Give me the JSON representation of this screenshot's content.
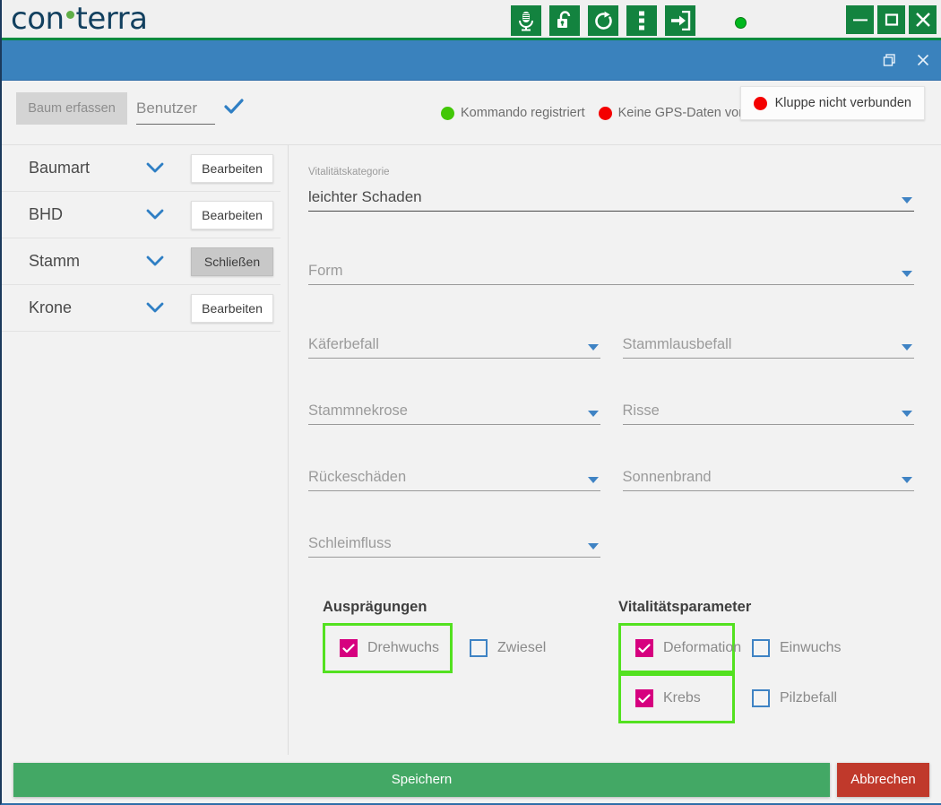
{
  "brand": {
    "logo_part1": "con",
    "logo_part2": "terra",
    "logo_dot": "green-dot"
  },
  "toolbar": {
    "icons": [
      {
        "name": "microphone-icon",
        "label": "Mikrofon"
      },
      {
        "name": "unlock-icon",
        "label": "Entsperren"
      },
      {
        "name": "refresh-icon",
        "label": "Aktualisieren"
      },
      {
        "name": "more-vertical-icon",
        "label": "Mehr"
      },
      {
        "name": "login-icon",
        "label": "Anmelden"
      }
    ],
    "status_led": "green"
  },
  "window_controls": {
    "minimize": "minimize-icon",
    "maximize": "maximize-icon",
    "close": "close-icon"
  },
  "sub_window": {
    "restore": "restore-icon",
    "close": "close-icon"
  },
  "action_bar": {
    "capture_button": "Baum erfassen",
    "user_placeholder": "Benutzer",
    "user_value": "",
    "confirm_icon": "check-icon",
    "status": [
      {
        "label": "Kommando registriert",
        "color": "#42c707"
      },
      {
        "label": "Keine GPS-Daten von",
        "color": "#f40000"
      }
    ],
    "caliper_button": {
      "label": "Kluppe nicht verbunden",
      "color": "#f40000"
    }
  },
  "sidebar": {
    "items": [
      {
        "label": "Baumart",
        "button": "Bearbeiten",
        "active": false
      },
      {
        "label": "BHD",
        "button": "Bearbeiten",
        "active": false
      },
      {
        "label": "Stamm",
        "button": "Schließen",
        "active": true
      },
      {
        "label": "Krone",
        "button": "Bearbeiten",
        "active": false
      }
    ]
  },
  "form": {
    "vitality_category": {
      "label": "Vitalitätskategorie",
      "value": "leichter Schaden"
    },
    "form_field": {
      "placeholder": "Form",
      "value": ""
    },
    "fields": [
      {
        "placeholder": "Käferbefall",
        "value": ""
      },
      {
        "placeholder": "Stammlausbefall",
        "value": ""
      },
      {
        "placeholder": "Stammnekrose",
        "value": ""
      },
      {
        "placeholder": "Risse",
        "value": ""
      },
      {
        "placeholder": "Rückeschäden",
        "value": ""
      },
      {
        "placeholder": "Sonnenbrand",
        "value": ""
      },
      {
        "placeholder": "Schleimfluss",
        "value": ""
      }
    ]
  },
  "groups": {
    "auspraegungen": {
      "title": "Ausprägungen",
      "items": [
        {
          "label": "Drehwuchs",
          "checked": true,
          "highlighted": true
        },
        {
          "label": "Zwiesel",
          "checked": false,
          "highlighted": false
        }
      ]
    },
    "vitalitaetsparameter": {
      "title": "Vitalitätsparameter",
      "items": [
        {
          "label": "Deformation",
          "checked": true,
          "highlighted": true
        },
        {
          "label": "Einwuchs",
          "checked": false,
          "highlighted": false
        },
        {
          "label": "Krebs",
          "checked": true,
          "highlighted": true
        },
        {
          "label": "Pilzbefall",
          "checked": false,
          "highlighted": false
        }
      ]
    }
  },
  "footer": {
    "save": "Speichern",
    "cancel": "Abbrechen"
  },
  "colors": {
    "brand_green": "#13833f",
    "brand_navy": "#12405f",
    "accent_blue": "#3a82bd",
    "checked_pink": "#d6007f",
    "highlight_green": "#53e120",
    "save_green": "#43a865",
    "cancel_red": "#c0392b"
  }
}
